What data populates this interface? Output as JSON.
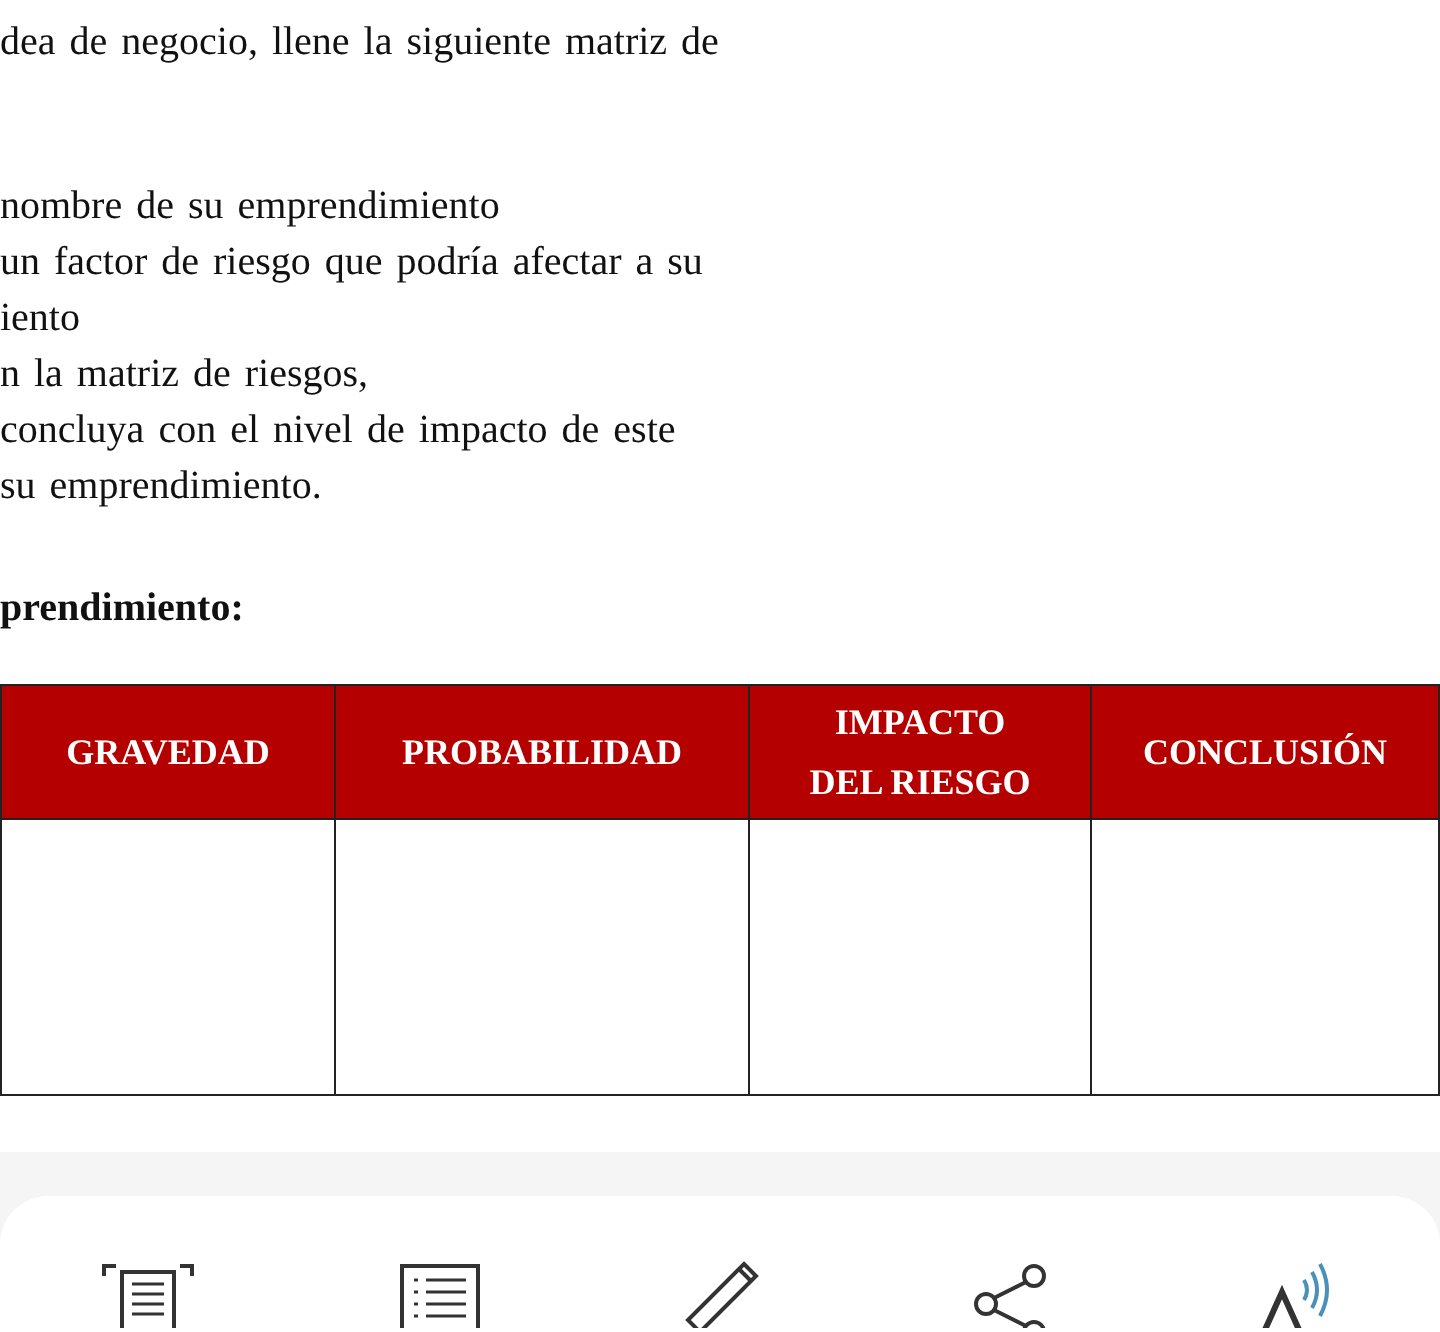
{
  "intro_line": {
    "text": "dea de negocio, llene la siguiente matriz de"
  },
  "instructions": [
    {
      "text": "nombre de su emprendimiento"
    },
    {
      "text": "un factor de riesgo que podría afectar a su"
    },
    {
      "text": "iento"
    },
    {
      "text": "n la matriz de riesgos,"
    },
    {
      "text": "concluya con el nivel de impacto de este"
    },
    {
      "text": "su emprendimiento."
    }
  ],
  "heading": "prendimiento:",
  "table": {
    "columns": [
      "GRAVEDAD",
      "PROBABILIDAD",
      "IMPACTO DEL RIESGO",
      "CONCLUSIÓN"
    ]
  },
  "toolbar": {
    "buttons": [
      {
        "kind": "fit"
      },
      {
        "kind": "outline"
      },
      {
        "kind": "annotate"
      },
      {
        "kind": "share"
      },
      {
        "kind": "read-aloud"
      }
    ]
  }
}
